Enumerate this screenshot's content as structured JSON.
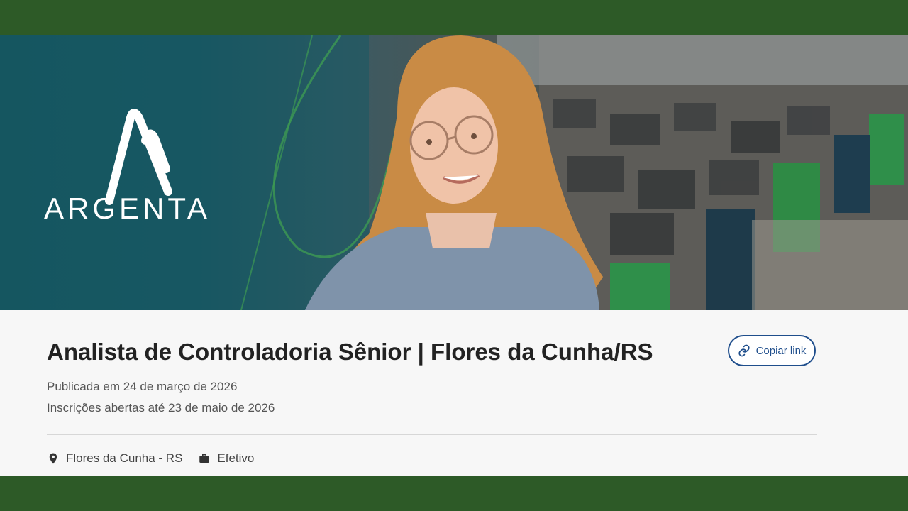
{
  "brand": {
    "name": "ARGENTA"
  },
  "job": {
    "title": "Analista de Controladoria Sênior | Flores da Cunha/RS",
    "published": "Publicada em 24 de março de 2026",
    "deadline": "Inscrições abertas até 23 de maio de 2026",
    "location": "Flores da Cunha - RS",
    "contract": "Efetivo"
  },
  "actions": {
    "copy_link_label": "Copiar link"
  },
  "icons": {
    "copy": "link-icon",
    "location": "map-pin-icon",
    "contract": "briefcase-icon"
  },
  "colors": {
    "frame": "#2d5a27",
    "accent": "#1f4e8c",
    "banner_teal": "#15535c",
    "title": "#222222"
  }
}
